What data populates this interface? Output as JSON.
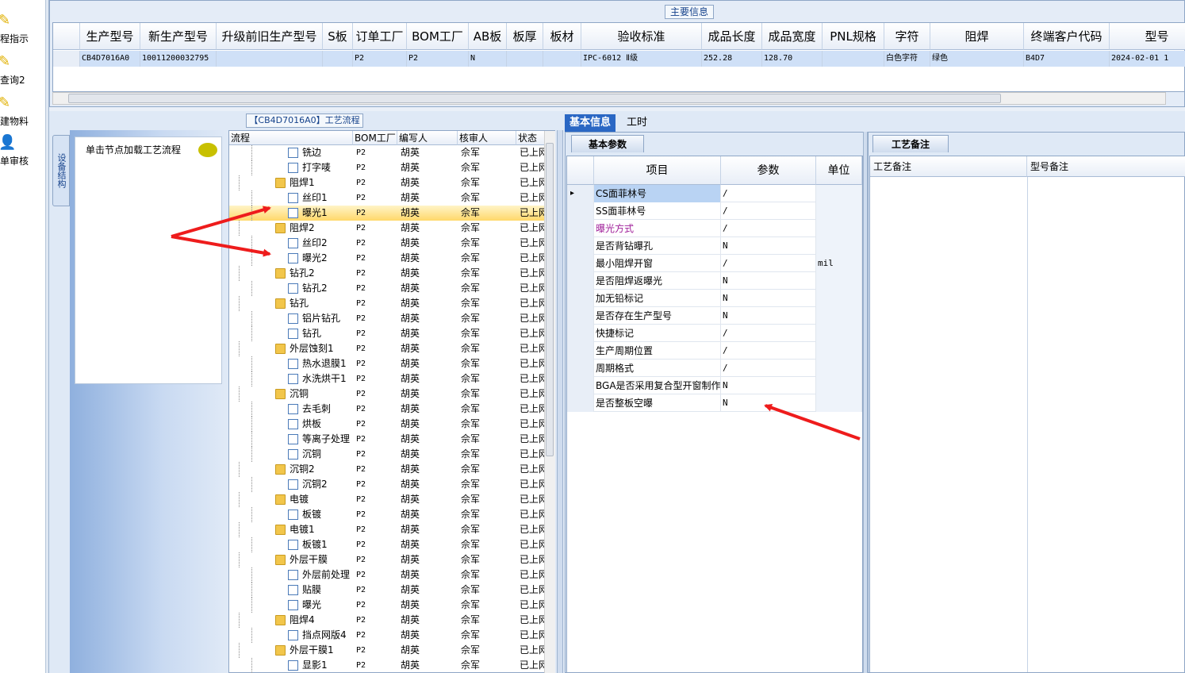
{
  "left_toolbar": {
    "items": [
      {
        "label": "程指示",
        "icon": "pencil-icon"
      },
      {
        "label": "查询2",
        "icon": "pencil-icon"
      },
      {
        "label": "建物料",
        "icon": "pencil-icon"
      },
      {
        "label": "单审核",
        "icon": "user-icon"
      }
    ]
  },
  "main_info": {
    "title": "主要信息",
    "columns": [
      "生产型号",
      "新生产型号",
      "升级前旧生产型号",
      "S板",
      "订单工厂",
      "BOM工厂",
      "AB板",
      "板厚",
      "板材",
      "验收标准",
      "成品长度",
      "成品宽度",
      "PNL规格",
      "字符",
      "阻焊",
      "终端客户代码",
      "型号"
    ],
    "row": [
      "CB4D7016A0",
      "10011200032795",
      "",
      "",
      "P2",
      "P2",
      "N",
      "",
      "",
      "IPC-6012 Ⅱ级",
      "252.28",
      "128.70",
      "",
      "白色字符",
      "绿色",
      "B4D7",
      "2024-02-01 1"
    ]
  },
  "process": {
    "title": "【CB4D7016A0】工艺流程",
    "side_tab": "设备结构",
    "struct_hint": "单击节点加载工艺流程",
    "columns": [
      "流程",
      "BOM工厂",
      "编写人",
      "核审人",
      "状态"
    ],
    "rows": [
      {
        "name": "铣边",
        "level": 1,
        "type": "file",
        "factory": "P2",
        "writer": "胡英",
        "reviewer": "佘军",
        "status": "已上网"
      },
      {
        "name": "打字唛",
        "level": 1,
        "type": "file",
        "factory": "P2",
        "writer": "胡英",
        "reviewer": "佘军",
        "status": "已上网"
      },
      {
        "name": "阻焊1",
        "level": 0,
        "type": "folder",
        "factory": "P2",
        "writer": "胡英",
        "reviewer": "佘军",
        "status": "已上网"
      },
      {
        "name": "丝印1",
        "level": 1,
        "type": "file",
        "factory": "P2",
        "writer": "胡英",
        "reviewer": "佘军",
        "status": "已上网"
      },
      {
        "name": "曝光1",
        "level": 1,
        "type": "file",
        "factory": "P2",
        "writer": "胡英",
        "reviewer": "佘军",
        "status": "已上网",
        "selected": true
      },
      {
        "name": "阻焊2",
        "level": 0,
        "type": "folder",
        "factory": "P2",
        "writer": "胡英",
        "reviewer": "佘军",
        "status": "已上网"
      },
      {
        "name": "丝印2",
        "level": 1,
        "type": "file",
        "factory": "P2",
        "writer": "胡英",
        "reviewer": "佘军",
        "status": "已上网"
      },
      {
        "name": "曝光2",
        "level": 1,
        "type": "file",
        "factory": "P2",
        "writer": "胡英",
        "reviewer": "佘军",
        "status": "已上网"
      },
      {
        "name": "钻孔2",
        "level": 0,
        "type": "folder",
        "factory": "P2",
        "writer": "胡英",
        "reviewer": "佘军",
        "status": "已上网"
      },
      {
        "name": "钻孔2",
        "level": 1,
        "type": "file",
        "factory": "P2",
        "writer": "胡英",
        "reviewer": "佘军",
        "status": "已上网"
      },
      {
        "name": "钻孔",
        "level": 0,
        "type": "folder",
        "factory": "P2",
        "writer": "胡英",
        "reviewer": "佘军",
        "status": "已上网"
      },
      {
        "name": "铝片钻孔",
        "level": 1,
        "type": "file",
        "factory": "P2",
        "writer": "胡英",
        "reviewer": "佘军",
        "status": "已上网"
      },
      {
        "name": "钻孔",
        "level": 1,
        "type": "file",
        "factory": "P2",
        "writer": "胡英",
        "reviewer": "佘军",
        "status": "已上网"
      },
      {
        "name": "外层蚀刻1",
        "level": 0,
        "type": "folder",
        "factory": "P2",
        "writer": "胡英",
        "reviewer": "佘军",
        "status": "已上网"
      },
      {
        "name": "热水退膜1",
        "level": 1,
        "type": "file",
        "factory": "P2",
        "writer": "胡英",
        "reviewer": "佘军",
        "status": "已上网"
      },
      {
        "name": "水洗烘干1",
        "level": 1,
        "type": "file",
        "factory": "P2",
        "writer": "胡英",
        "reviewer": "佘军",
        "status": "已上网"
      },
      {
        "name": "沉铜",
        "level": 0,
        "type": "folder",
        "factory": "P2",
        "writer": "胡英",
        "reviewer": "佘军",
        "status": "已上网"
      },
      {
        "name": "去毛刺",
        "level": 1,
        "type": "file",
        "factory": "P2",
        "writer": "胡英",
        "reviewer": "佘军",
        "status": "已上网"
      },
      {
        "name": "烘板",
        "level": 1,
        "type": "file",
        "factory": "P2",
        "writer": "胡英",
        "reviewer": "佘军",
        "status": "已上网"
      },
      {
        "name": "等离子处理",
        "level": 1,
        "type": "file",
        "factory": "P2",
        "writer": "胡英",
        "reviewer": "佘军",
        "status": "已上网"
      },
      {
        "name": "沉铜",
        "level": 1,
        "type": "file",
        "factory": "P2",
        "writer": "胡英",
        "reviewer": "佘军",
        "status": "已上网"
      },
      {
        "name": "沉铜2",
        "level": 0,
        "type": "folder",
        "factory": "P2",
        "writer": "胡英",
        "reviewer": "佘军",
        "status": "已上网"
      },
      {
        "name": "沉铜2",
        "level": 1,
        "type": "file",
        "factory": "P2",
        "writer": "胡英",
        "reviewer": "佘军",
        "status": "已上网"
      },
      {
        "name": "电镀",
        "level": 0,
        "type": "folder",
        "factory": "P2",
        "writer": "胡英",
        "reviewer": "佘军",
        "status": "已上网"
      },
      {
        "name": "板镀",
        "level": 1,
        "type": "file",
        "factory": "P2",
        "writer": "胡英",
        "reviewer": "佘军",
        "status": "已上网"
      },
      {
        "name": "电镀1",
        "level": 0,
        "type": "folder",
        "factory": "P2",
        "writer": "胡英",
        "reviewer": "佘军",
        "status": "已上网"
      },
      {
        "name": "板镀1",
        "level": 1,
        "type": "file",
        "factory": "P2",
        "writer": "胡英",
        "reviewer": "佘军",
        "status": "已上网"
      },
      {
        "name": "外层干膜",
        "level": 0,
        "type": "folder",
        "factory": "P2",
        "writer": "胡英",
        "reviewer": "佘军",
        "status": "已上网"
      },
      {
        "name": "外层前处理",
        "level": 1,
        "type": "file",
        "factory": "P2",
        "writer": "胡英",
        "reviewer": "佘军",
        "status": "已上网"
      },
      {
        "name": "贴膜",
        "level": 1,
        "type": "file",
        "factory": "P2",
        "writer": "胡英",
        "reviewer": "佘军",
        "status": "已上网"
      },
      {
        "name": "曝光",
        "level": 1,
        "type": "file",
        "factory": "P2",
        "writer": "胡英",
        "reviewer": "佘军",
        "status": "已上网"
      },
      {
        "name": "阻焊4",
        "level": 0,
        "type": "folder",
        "factory": "P2",
        "writer": "胡英",
        "reviewer": "佘军",
        "status": "已上网"
      },
      {
        "name": "挡点网版4",
        "level": 1,
        "type": "file",
        "factory": "P2",
        "writer": "胡英",
        "reviewer": "佘军",
        "status": "已上网"
      },
      {
        "name": "外层干膜1",
        "level": 0,
        "type": "folder",
        "factory": "P2",
        "writer": "胡英",
        "reviewer": "佘军",
        "status": "已上网"
      },
      {
        "name": "显影1",
        "level": 1,
        "type": "file",
        "factory": "P2",
        "writer": "胡英",
        "reviewer": "佘军",
        "status": "已上网"
      }
    ]
  },
  "details": {
    "tabs": [
      "基本信息",
      "工时"
    ],
    "params_title": "基本参数",
    "param_columns": [
      "项目",
      "参数",
      "单位"
    ],
    "params": [
      {
        "item": "CS面菲林号",
        "value": "/",
        "unit": "",
        "current": true
      },
      {
        "item": "SS面菲林号",
        "value": "/",
        "unit": ""
      },
      {
        "item": "曝光方式",
        "value": "/",
        "unit": "",
        "color": "#a0209a"
      },
      {
        "item": "是否背钻曝孔",
        "value": "N",
        "unit": ""
      },
      {
        "item": "最小阻焊开窗",
        "value": "/",
        "unit": "mil"
      },
      {
        "item": "是否阻焊返曝光",
        "value": "N",
        "unit": ""
      },
      {
        "item": "加无铅标记",
        "value": "N",
        "unit": ""
      },
      {
        "item": "是否存在生产型号",
        "value": "N",
        "unit": ""
      },
      {
        "item": "快捷标记",
        "value": "/",
        "unit": ""
      },
      {
        "item": "生产周期位置",
        "value": "/",
        "unit": ""
      },
      {
        "item": "周期格式",
        "value": "/",
        "unit": ""
      },
      {
        "item": "BGA是否采用复合型开窗制作",
        "value": "N",
        "unit": ""
      },
      {
        "item": "是否整板空曝",
        "value": "N",
        "unit": ""
      }
    ],
    "notes_title": "工艺备注",
    "note_columns": [
      "工艺备注",
      "型号备注"
    ]
  },
  "colors": {
    "accent": "#2a67c4",
    "selected_row": "#ffd86a",
    "annotation_arrow": "#ee1c1c"
  }
}
